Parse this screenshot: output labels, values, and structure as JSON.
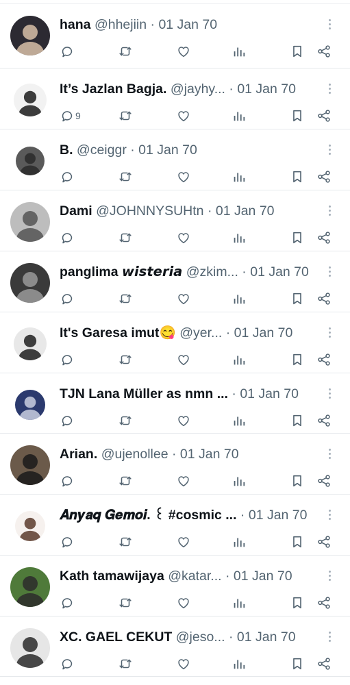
{
  "rows": [
    {
      "name": "hana",
      "handle": "@hhejiin",
      "date": "01 Jan 70",
      "reply_count": "",
      "avatar_colors": [
        "#2c2a32",
        "#d8c0a8"
      ]
    },
    {
      "name": "It’s Jazlan Bagja.",
      "handle": "@jayhy...",
      "date": "01 Jan 70",
      "reply_count": "9",
      "avatar_colors": [
        "#f2f2f2",
        "#1c1c1c"
      ]
    },
    {
      "name": "B.",
      "handle": "@ceiggr",
      "date": "01 Jan 70",
      "reply_count": "",
      "avatar_colors": [
        "#5a5a5a",
        "#2a2a2a"
      ]
    },
    {
      "name": "Dami",
      "handle": "@JOHNNYSUHtn",
      "date": "01 Jan 70",
      "reply_count": "",
      "avatar_colors": [
        "#bdbdbd",
        "#555555"
      ]
    },
    {
      "name": "panglima 𝙬𝙞𝙨𝙩𝙚𝙧𝙞𝙖",
      "handle": "@zkim...",
      "date": "01 Jan 70",
      "reply_count": "",
      "avatar_colors": [
        "#3a3a3a",
        "#9a9a9a"
      ]
    },
    {
      "name": "It's Garesa imut😋",
      "handle": "@yer...",
      "date": "01 Jan 70",
      "reply_count": "",
      "avatar_colors": [
        "#e8e8e8",
        "#1e1e1e"
      ]
    },
    {
      "name": "TJN Lana Müller as nmn ...",
      "handle": "",
      "date": "01 Jan 70",
      "reply_count": "",
      "avatar_colors": [
        "#2b3a6e",
        "#c9cfe0"
      ]
    },
    {
      "name": "Arian.",
      "handle": "@ujenollee",
      "date": "01 Jan 70",
      "reply_count": "",
      "avatar_colors": [
        "#6b5a4a",
        "#1a1a1a"
      ]
    },
    {
      "name": "𝑨𝒏𝒚𝒂𝒒 𝑮𝒆𝒎𝒐𝒊. ꒰ #cosmic ...",
      "handle": "",
      "date": "01 Jan 70",
      "reply_count": "",
      "avatar_colors": [
        "#f6f1ee",
        "#5a3b2b"
      ]
    },
    {
      "name": "Kath tamawijaya",
      "handle": "@katar...",
      "date": "01 Jan 70",
      "reply_count": "",
      "avatar_colors": [
        "#4f7a3a",
        "#2c2c2c"
      ]
    },
    {
      "name": "XC. GAEL CEKUT",
      "handle": "@jeso...",
      "date": "01 Jan 70",
      "reply_count": "",
      "avatar_colors": [
        "#e6e6e6",
        "#2a2a2a"
      ]
    }
  ],
  "separator": "·",
  "icons": {
    "reply": "reply-icon",
    "retweet": "retweet-icon",
    "like": "heart-icon",
    "views": "views-icon",
    "bookmark": "bookmark-icon",
    "share": "share-icon",
    "more": "more-icon"
  },
  "colors": {
    "text": "#0f1419",
    "secondary": "#536471",
    "divider": "#e6e9ec"
  }
}
